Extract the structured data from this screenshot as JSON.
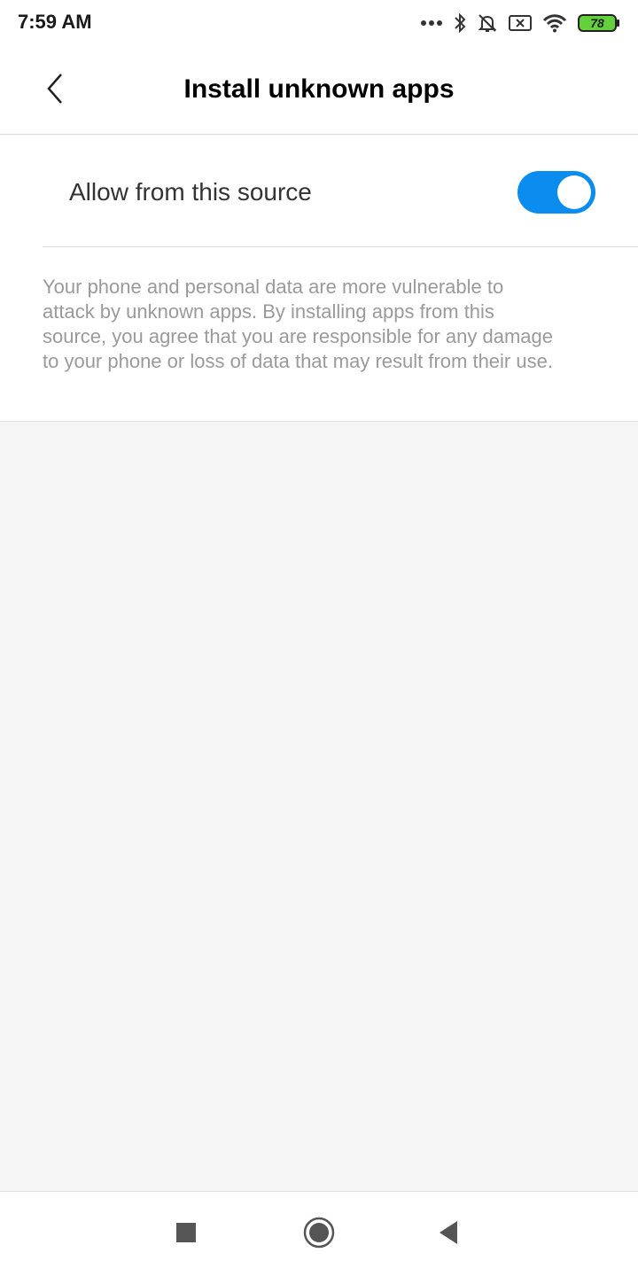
{
  "status_bar": {
    "time": "7:59 AM",
    "battery_level": "78",
    "icons": [
      "more-dots-icon",
      "bluetooth-icon",
      "notifications-off-icon",
      "sim-error-icon",
      "wifi-icon",
      "battery-icon"
    ]
  },
  "header": {
    "title": "Install unknown apps",
    "back_icon": "chevron-left-icon"
  },
  "setting": {
    "label": "Allow from this source",
    "toggle_on": true,
    "accent_color": "#0b8def"
  },
  "warning": {
    "text": "Your phone and personal data are more vulnerable to attack by unknown apps. By installing apps from this source, you agree that you are responsible for any damage to your phone or loss of data that may result from their use."
  },
  "nav_bar": {
    "buttons": [
      "recents-square-icon",
      "home-circle-icon",
      "back-triangle-icon"
    ]
  }
}
